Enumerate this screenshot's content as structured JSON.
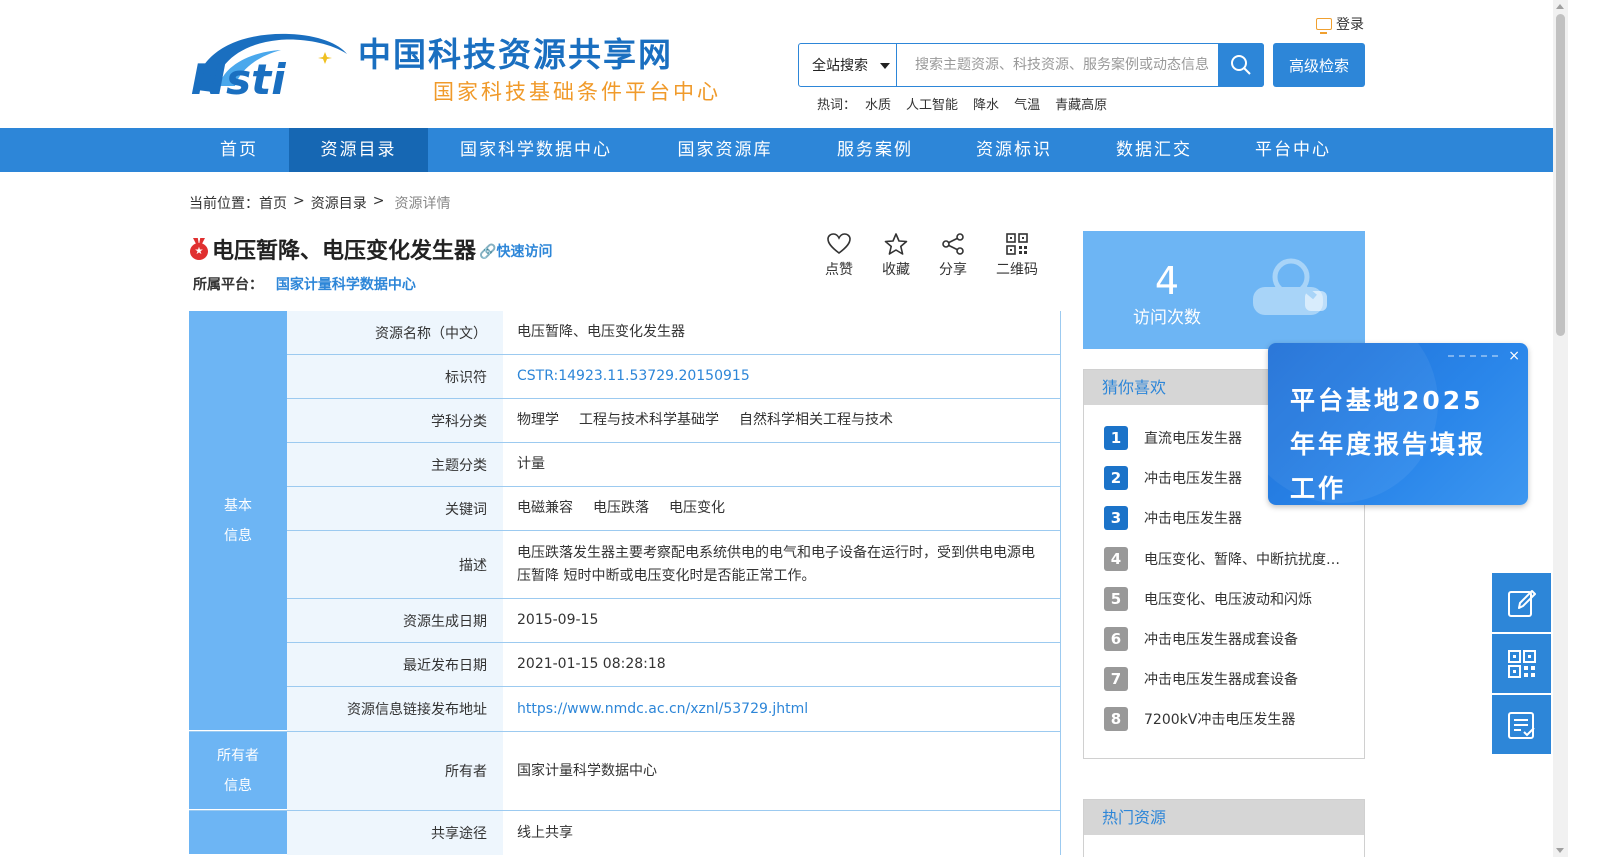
{
  "header": {
    "site_title": "中国科技资源共享网",
    "site_subtitle": "国家科技基础条件平台中心",
    "login_label": "登录",
    "search_scope": "全站搜索",
    "search_placeholder": "搜索主题资源、科技资源、服务案例或动态信息",
    "advanced_search_label": "高级检索",
    "hotwords_label": "热词：",
    "hotwords": [
      "水质",
      "人工智能",
      "降水",
      "气温",
      "青藏高原"
    ]
  },
  "nav": {
    "items": [
      "首页",
      "资源目录",
      "国家科学数据中心",
      "国家资源库",
      "服务案例",
      "资源标识",
      "数据汇交",
      "平台中心"
    ],
    "active_index": 1
  },
  "breadcrumb": {
    "prefix": "当前位置：",
    "items": [
      "首页",
      "资源目录"
    ],
    "separator": ">",
    "current": "资源详情"
  },
  "resource": {
    "title": "电压暂降、电压变化发生器",
    "quick_visit": "快速访问",
    "platform_label": "所属平台：",
    "platform_name": "国家计量科学数据中心"
  },
  "actions": {
    "like": "点赞",
    "favorite": "收藏",
    "share": "分享",
    "qrcode": "二维码"
  },
  "info": {
    "groups": [
      {
        "label_lines": [
          "基本",
          "信息"
        ],
        "rows": [
          {
            "label": "资源名称（中文）",
            "value": "电压暂降、电压变化发生器"
          },
          {
            "label": "标识符",
            "value": "CSTR:14923.11.53729.20150915"
          },
          {
            "label": "学科分类",
            "tags": [
              "物理学",
              "工程与技术科学基础学",
              "自然科学相关工程与技术"
            ]
          },
          {
            "label": "主题分类",
            "value": "计量"
          },
          {
            "label": "关键词",
            "tags": [
              "电磁兼容",
              "电压跌落",
              "电压变化"
            ]
          },
          {
            "label": "描述",
            "value": "电压跌落发生器主要考察配电系统供电的电气和电子设备在运行时，受到供电电源电压暂降 短时中断或电压变化时是否能正常工作。"
          },
          {
            "label": "资源生成日期",
            "value": "2015-09-15"
          },
          {
            "label": "最近发布日期",
            "value": "2021-01-15 08:28:18"
          },
          {
            "label": "资源信息链接发布地址",
            "value": "https://www.nmdc.ac.cn/xznl/53729.jhtml"
          }
        ]
      },
      {
        "label_lines": [
          "所有者",
          "信息"
        ],
        "rows": [
          {
            "label": "所有者",
            "value": "国家计量科学数据中心"
          }
        ]
      },
      {
        "label_lines": [
          ""
        ],
        "rows": [
          {
            "label": "共享途径",
            "value": "线上共享"
          }
        ]
      }
    ]
  },
  "visits": {
    "count": "4",
    "label": "访问次数"
  },
  "guess": {
    "title": "猜你喜欢",
    "items": [
      {
        "rank": "1",
        "text": "直流电压发生器"
      },
      {
        "rank": "2",
        "text": "冲击电压发生器"
      },
      {
        "rank": "3",
        "text": "冲击电压发生器"
      },
      {
        "rank": "4",
        "text": "电压变化、暂降、中断抗扰度试验"
      },
      {
        "rank": "5",
        "text": "电压变化、电压波动和闪烁"
      },
      {
        "rank": "6",
        "text": "冲击电压发生器成套设备"
      },
      {
        "rank": "7",
        "text": "冲击电压发生器成套设备"
      },
      {
        "rank": "8",
        "text": "7200kV冲击电压发生器"
      }
    ]
  },
  "hot": {
    "title": "热门资源"
  },
  "popup": {
    "text": "平台基地2025年年度报告填报工作",
    "close": "×"
  },
  "colors": {
    "primary": "#2d86d8",
    "nav_active": "#1667b3",
    "label_blue": "#6db5f4",
    "orange": "#f09a2a",
    "rank_top": "#1b73c9",
    "rank_other": "#999999"
  }
}
